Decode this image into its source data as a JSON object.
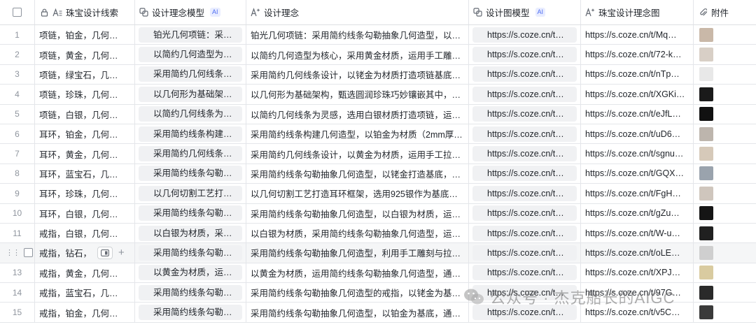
{
  "columns": {
    "c1": "珠宝设计线索",
    "c2": "设计理念模型",
    "c2_badge": "AI",
    "c3": "设计理念",
    "c4": "设计图模型",
    "c4_badge": "AI",
    "c5": "珠宝设计理念图",
    "c6": "附件"
  },
  "rows": [
    {
      "n": "1",
      "clue": "项链，铂金，几何…",
      "model": "铂光几何项链：采…",
      "concept": "铂光几何项链：采用简约线条勾勒抽象几何造型，以…",
      "img_model": "https://s.coze.cn/t…",
      "img": "https://s.coze.cn/t/Mq…",
      "thumb": "#c9b8a8"
    },
    {
      "n": "2",
      "clue": "项链，黄金，几何…",
      "model": "以简约几何造型为…",
      "concept": "以简约几何造型为核心，采用黄金材质，运用手工雕…",
      "img_model": "https://s.coze.cn/t…",
      "img": "https://s.coze.cn/t/72-k…",
      "thumb": "#d8cfc6"
    },
    {
      "n": "3",
      "clue": "项链，绿宝石，几…",
      "model": "采用简约几何线条…",
      "concept": "采用简约几何线条设计，以铑金为材质打造项链基底…",
      "img_model": "https://s.coze.cn/t…",
      "img": "https://s.coze.cn/t/nTp…",
      "thumb": "#e8e8e8"
    },
    {
      "n": "4",
      "clue": "项链，珍珠，几何…",
      "model": "以几何形为基础架…",
      "concept": "以几何形为基础架构，甄选圆润珍珠巧妙镶嵌其中，…",
      "img_model": "https://s.coze.cn/t…",
      "img": "https://s.coze.cn/t/XGKi…",
      "thumb": "#1a1a1a"
    },
    {
      "n": "5",
      "clue": "项链，白银，几何…",
      "model": "以简约几何线条为…",
      "concept": "以简约几何线条为灵感，选用白银材质打造项链，运…",
      "img_model": "https://s.coze.cn/t…",
      "img": "https://s.coze.cn/t/eJfL…",
      "thumb": "#111111"
    },
    {
      "n": "6",
      "clue": "耳环，铂金，几何…",
      "model": "采用简约线条构建…",
      "concept": "采用简约线条构建几何造型，以铂金为材质（2mm厚…",
      "img_model": "https://s.coze.cn/t…",
      "img": "https://s.coze.cn/t/uD6…",
      "thumb": "#bdb5ad"
    },
    {
      "n": "7",
      "clue": "耳环，黄金，几何…",
      "model": "采用简约几何线条…",
      "concept": "采用简约几何线条设计，以黄金为材质，运用手工拉…",
      "img_model": "https://s.coze.cn/t…",
      "img": "https://s.coze.cn/t/sgnu…",
      "thumb": "#d6c9b9"
    },
    {
      "n": "8",
      "clue": "耳环，蓝宝石，几…",
      "model": "采用简约线条勾勒…",
      "concept": "采用简约线条勾勒抽象几何造型，以铑金打造基底，…",
      "img_model": "https://s.coze.cn/t…",
      "img": "https://s.coze.cn/t/GQX…",
      "thumb": "#9aa3ad"
    },
    {
      "n": "9",
      "clue": "耳环，珍珠，几何…",
      "model": "以几何切割工艺打…",
      "concept": "以几何切割工艺打造耳环框架，选用925银作为基底…",
      "img_model": "https://s.coze.cn/t…",
      "img": "https://s.coze.cn/t/FgH…",
      "thumb": "#cfc6bd"
    },
    {
      "n": "10",
      "clue": "耳环，白银，几何…",
      "model": "采用简约线条勾勒…",
      "concept": "采用简约线条勾勒抽象几何造型，以白银为材质，运…",
      "img_model": "https://s.coze.cn/t…",
      "img": "https://s.coze.cn/t/gZu…",
      "thumb": "#151515"
    },
    {
      "n": "11",
      "clue": "戒指，白银，几何…",
      "model": "以白银为材质，采…",
      "concept": "以白银为材质，采用简约线条勾勒抽象几何造型，运…",
      "img_model": "https://s.coze.cn/t…",
      "img": "https://s.coze.cn/t/W-u…",
      "thumb": "#202020"
    },
    {
      "n": "",
      "clue": "戒指，钻石，",
      "model": "采用简约线条勾勒…",
      "concept": "采用简约线条勾勒抽象几何造型，利用手工雕刻与拉…",
      "img_model": "https://s.coze.cn/t…",
      "img": "https://s.coze.cn/t/oLE…",
      "thumb": "#cfcfcf"
    },
    {
      "n": "13",
      "clue": "戒指，黄金，几何…",
      "model": "以黄金为材质，运…",
      "concept": "以黄金为材质，运用简约线条勾勒抽象几何造型，通…",
      "img_model": "https://s.coze.cn/t…",
      "img": "https://s.coze.cn/t/XPJ…",
      "thumb": "#d9cba0"
    },
    {
      "n": "14",
      "clue": "戒指，蓝宝石，几…",
      "model": "采用简约线条勾勒…",
      "concept": "采用简约线条勾勒抽象几何造型的戒指，以铑金为基…",
      "img_model": "https://s.coze.cn/t…",
      "img": "https://s.coze.cn/t/97G…",
      "thumb": "#2a2a2a"
    },
    {
      "n": "15",
      "clue": "戒指，铂金，几何…",
      "model": "采用简约线条勾勒…",
      "concept": "采用简约线条勾勒抽象几何造型，以铂金为基底，通…",
      "img_model": "https://s.coze.cn/t…",
      "img": "https://s.coze.cn/t/v5C…",
      "thumb": "#3a3a3a"
    }
  ],
  "hover_row_index": 11,
  "watermark": "公众号 · 杰克船长的AIGC"
}
